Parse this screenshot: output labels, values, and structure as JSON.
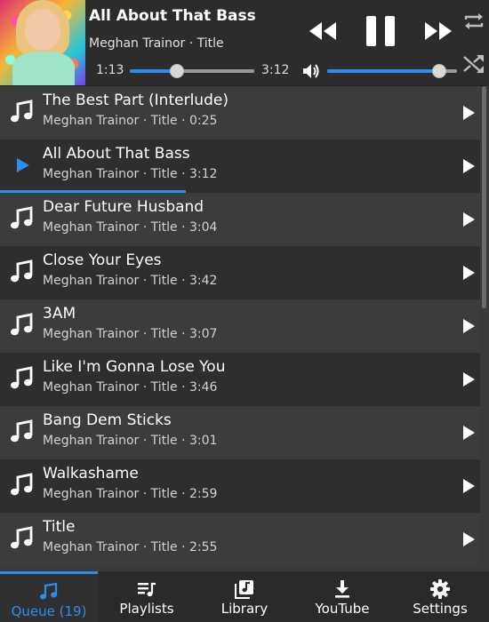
{
  "now_playing": {
    "title": "All About That Bass",
    "subtitle": "Meghan Trainor · Title",
    "current_time": "1:13",
    "total_time": "3:12",
    "progress": 0.38,
    "volume": 0.86
  },
  "queue": [
    {
      "title": "The Best Part (Interlude)",
      "meta": "Meghan Trainor · Title · 0:25",
      "playing": false
    },
    {
      "title": "All About That Bass",
      "meta": "Meghan Trainor · Title · 3:12",
      "playing": true,
      "progress": 0.38
    },
    {
      "title": "Dear Future Husband",
      "meta": "Meghan Trainor · Title · 3:04",
      "playing": false
    },
    {
      "title": "Close Your Eyes",
      "meta": "Meghan Trainor · Title · 3:42",
      "playing": false
    },
    {
      "title": "3AM",
      "meta": "Meghan Trainor · Title · 3:07",
      "playing": false
    },
    {
      "title": "Like I'm Gonna Lose You",
      "meta": "Meghan Trainor · Title · 3:46",
      "playing": false
    },
    {
      "title": "Bang Dem Sticks",
      "meta": "Meghan Trainor · Title · 3:01",
      "playing": false
    },
    {
      "title": "Walkashame",
      "meta": "Meghan Trainor · Title · 2:59",
      "playing": false
    },
    {
      "title": "Title",
      "meta": "Meghan Trainor · Title · 2:55",
      "playing": false
    }
  ],
  "nav": {
    "tabs": [
      {
        "label": "Queue (19)",
        "icon": "music-note-icon",
        "active": true
      },
      {
        "label": "Playlists",
        "icon": "playlist-icon",
        "active": false
      },
      {
        "label": "Library",
        "icon": "library-icon",
        "active": false
      },
      {
        "label": "YouTube",
        "icon": "download-icon",
        "active": false
      },
      {
        "label": "Settings",
        "icon": "gear-icon",
        "active": false
      }
    ]
  },
  "colors": {
    "accent": "#2d8cf0",
    "header_bg": "#2c2c2c",
    "row_dark": "#2e2e2e",
    "row_light": "#3c3c3c",
    "nav_bg": "#2a2a2a"
  }
}
